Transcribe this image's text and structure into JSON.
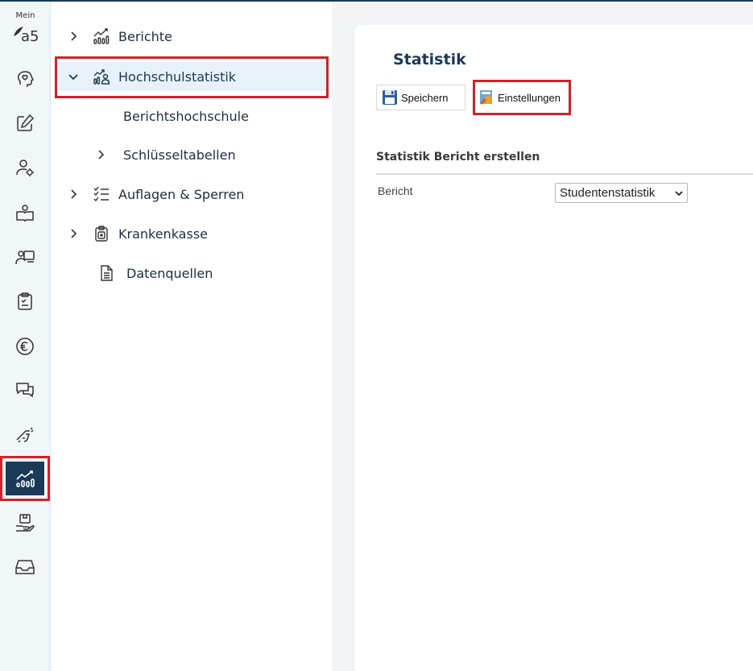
{
  "rail": {
    "mein_label": "Mein",
    "logo_text": "a5",
    "icons": [
      "head-icon",
      "edit-icon",
      "user-settings-icon",
      "book-user-icon",
      "teacher-board-icon",
      "clipboard-check-icon",
      "euro-icon",
      "chat-icon",
      "handshake-icon",
      "statistics-icon",
      "hand-box-icon",
      "inbox-icon"
    ],
    "active_icon": "statistics-icon"
  },
  "tree": {
    "items": [
      {
        "label": "Berichte",
        "icon": "chart-icon",
        "expanded": false
      },
      {
        "label": "Hochschulstatistik",
        "icon": "chart-user-icon",
        "expanded": true,
        "selected": true
      },
      {
        "label": "Berichtshochschule"
      },
      {
        "label": "Schlüsseltabellen",
        "expanded": false
      },
      {
        "label": "Auflagen & Sperren",
        "icon": "checklist-icon",
        "expanded": false
      },
      {
        "label": "Krankenkasse",
        "icon": "medical-clipboard-icon",
        "expanded": false
      },
      {
        "label": "Datenquellen",
        "icon": "document-icon"
      }
    ]
  },
  "main": {
    "title": "Statistik",
    "toolbar": {
      "save_label": "Speichern",
      "settings_label": "Einstellungen"
    },
    "section_title": "Statistik Bericht erstellen",
    "field_label": "Bericht",
    "select_value": "Studentenstatistik"
  },
  "colors": {
    "brand_navy": "#1b3a57",
    "highlight_red": "#d42027",
    "selection_bg": "#e8f1f9"
  }
}
